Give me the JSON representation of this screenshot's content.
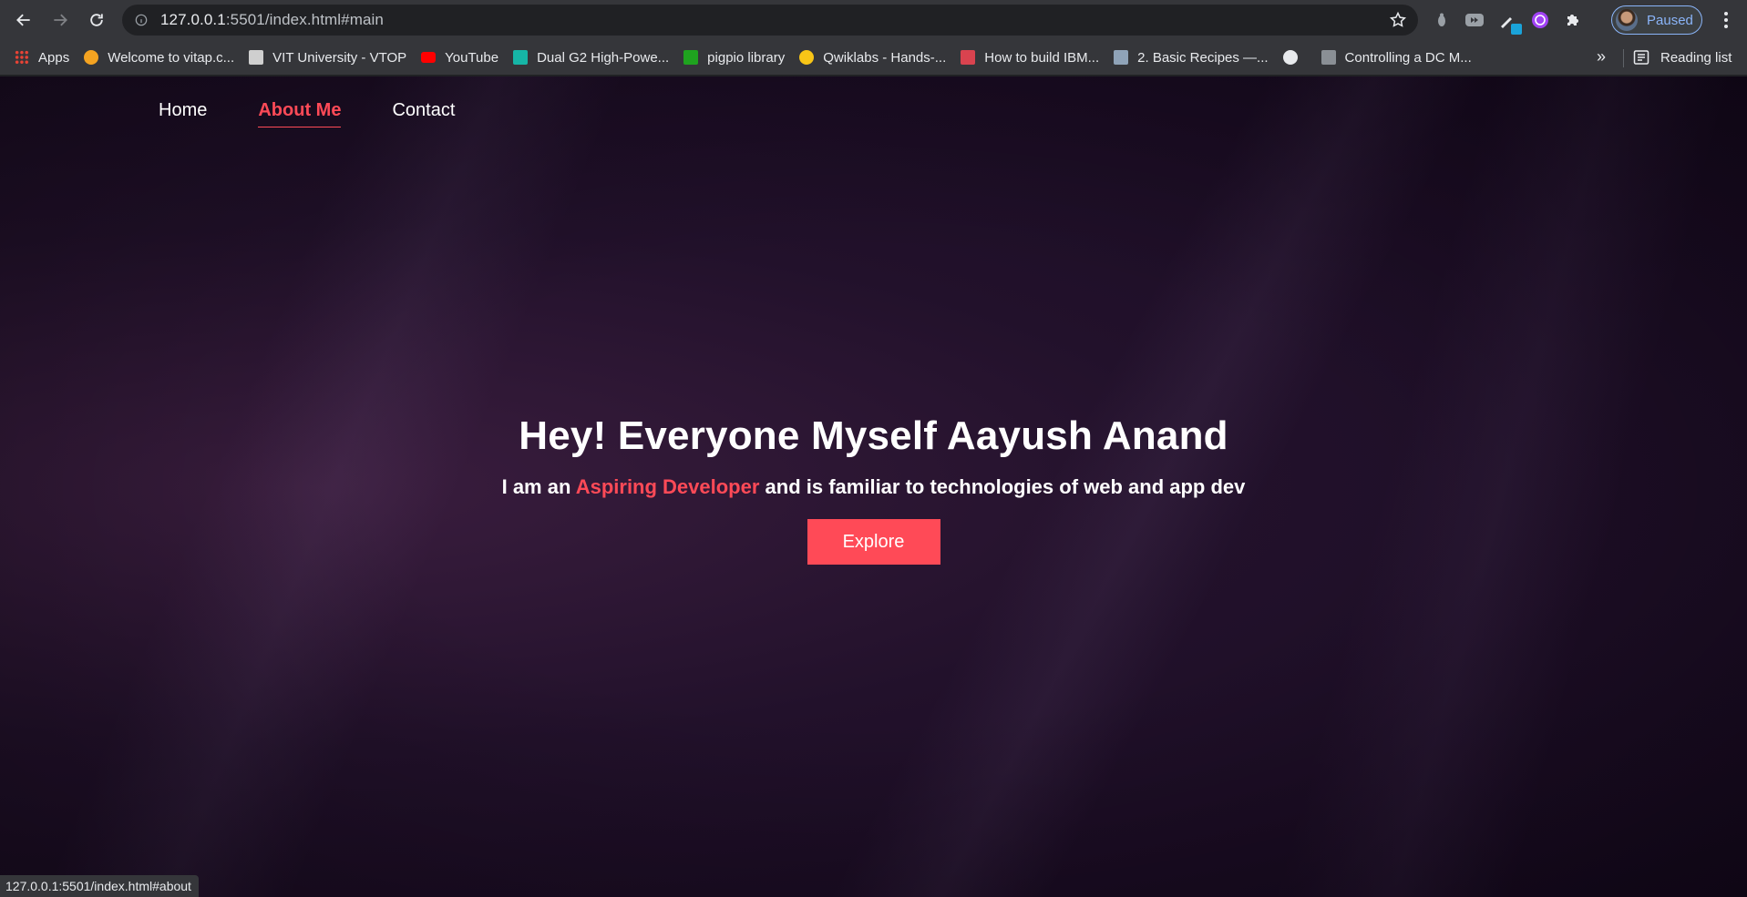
{
  "browser": {
    "url_host": "127.0.0.1",
    "url_rest": ":5501/index.html#main",
    "profile_label": "Paused",
    "status_url": "127.0.0.1:5501/index.html#about",
    "reading_list_label": "Reading list",
    "more_bookmarks": "»",
    "bookmarks": [
      {
        "label": "Apps",
        "icon": "apps-grid-icon",
        "color": "#ea4335"
      },
      {
        "label": "Welcome to vitap.c...",
        "icon": "sun-icon",
        "color": "#f4a321"
      },
      {
        "label": "VIT University - VTOP",
        "icon": "vit-logo-icon",
        "color": "#cfcfcf"
      },
      {
        "label": "YouTube",
        "icon": "youtube-icon",
        "color": "#ff0000"
      },
      {
        "label": "Dual G2 High-Powe...",
        "icon": "pololu-icon",
        "color": "#16b5a6"
      },
      {
        "label": "pigpio library",
        "icon": "pigpio-icon",
        "color": "#1fa31f"
      },
      {
        "label": "Qwiklabs - Hands-...",
        "icon": "qwiklabs-icon",
        "color": "#f8c517"
      },
      {
        "label": "How to build IBM...",
        "icon": "ibm-icon",
        "color": "#d9434f"
      },
      {
        "label": "2. Basic Recipes —...",
        "icon": "docs-icon",
        "color": "#8fa3b8"
      },
      {
        "label": "",
        "icon": "globe-icon",
        "color": "#e8eaed"
      },
      {
        "label": "Controlling a DC M...",
        "icon": "shield-icon",
        "color": "#8a8f95"
      }
    ]
  },
  "site": {
    "nav": [
      {
        "label": "Home",
        "active": false
      },
      {
        "label": "About Me",
        "active": true
      },
      {
        "label": "Contact",
        "active": false
      }
    ],
    "hero": {
      "title": "Hey! Everyone Myself Aayush Anand",
      "subtitle_before": "I am an ",
      "subtitle_accent": "Aspiring Developer",
      "subtitle_after": " and is familiar to technologies of web and app dev",
      "button_label": "Explore"
    },
    "colors": {
      "accent": "#ff4a57",
      "text": "#ffffff"
    }
  }
}
